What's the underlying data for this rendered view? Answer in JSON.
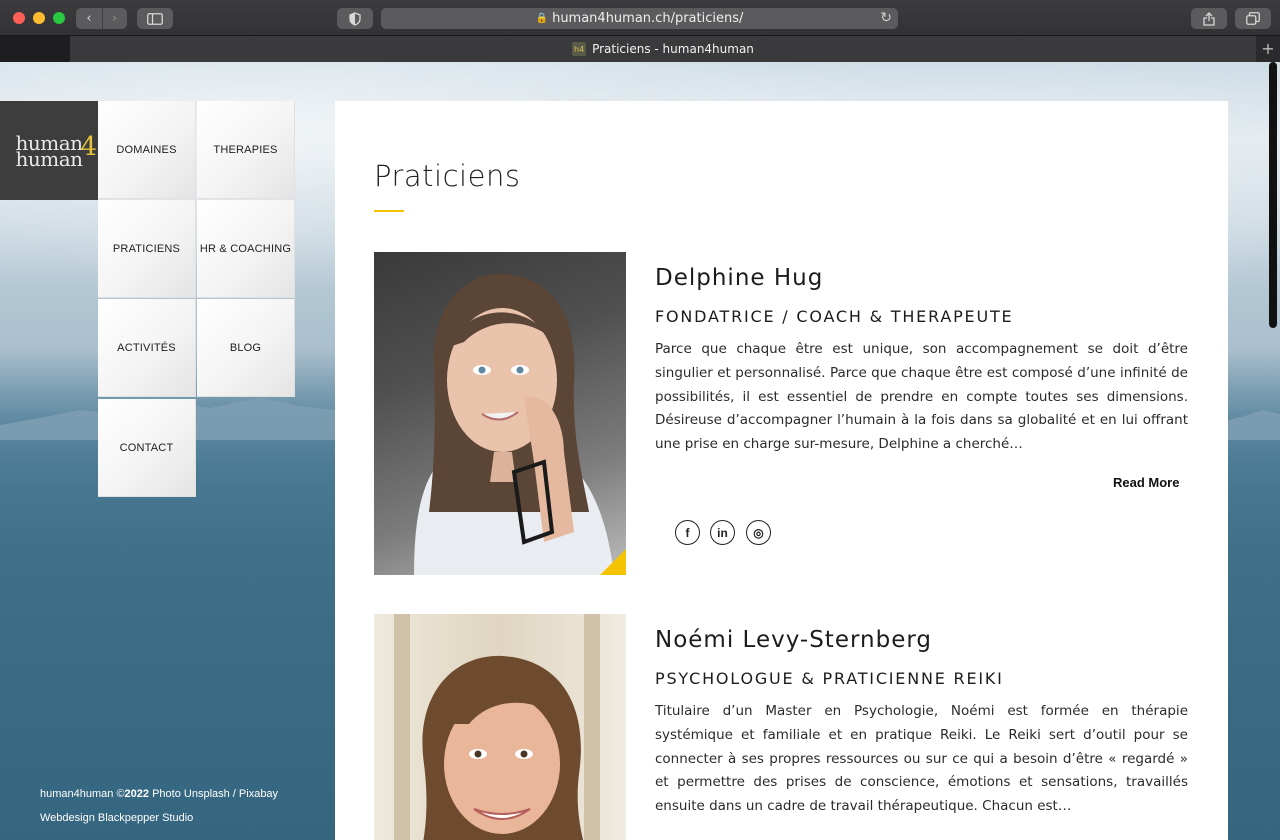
{
  "browser": {
    "url": "human4human.ch/praticiens/",
    "tab_title": "Praticiens - human4human",
    "favicon_text": "h4"
  },
  "logo": {
    "line1": "human",
    "line2": "human",
    "suffix": "4"
  },
  "nav": {
    "items": [
      {
        "label": "DOMAINES"
      },
      {
        "label": "THERAPIES"
      },
      {
        "label": "PRATICIENS"
      },
      {
        "label": "HR & COACHING"
      },
      {
        "label": "ACTIVITÉS"
      },
      {
        "label": "BLOG"
      },
      {
        "label": "CONTACT"
      }
    ]
  },
  "footer": {
    "line1_a": "human4human ©",
    "line1_year": "2022",
    "line1_b": " Photo Unsplash / Pixabay",
    "line2": "Webdesign Blackpepper Studio"
  },
  "page": {
    "title": "Praticiens",
    "accent_color": "#f2c200"
  },
  "practitioners": [
    {
      "name": "Delphine Hug",
      "role": "FONDATRICE / COACH & THERAPEUTE",
      "bio": "Parce que chaque être est unique, son accompagnement se doit d’être singulier et personnalisé. Parce que chaque être est composé d’une infinité de possibilités, il est essentiel de prendre en compte toutes ses dimensions. Désireuse d’accompagner l’humain à la fois dans sa globalité et en lui offrant une prise en charge sur-mesure, Delphine a cherché…",
      "read_more": "Read More",
      "social": [
        {
          "icon": "facebook-icon",
          "glyph": "f"
        },
        {
          "icon": "linkedin-icon",
          "glyph": "in"
        },
        {
          "icon": "instagram-icon",
          "glyph": "◎"
        }
      ]
    },
    {
      "name": "Noémi Levy-Sternberg",
      "role": "PSYCHOLOGUE & PRATICIENNE REIKI",
      "bio": "Titulaire d’un Master en Psychologie, Noémi est formée en thérapie systémique et familiale et en pratique Reiki. Le Reiki sert d’outil pour se connecter à ses propres ressources ou sur ce qui a besoin d’être « regardé » et permettre des prises de conscience, émotions et sensations, travaillés ensuite dans un cadre de travail thérapeutique. Chacun est…"
    }
  ]
}
